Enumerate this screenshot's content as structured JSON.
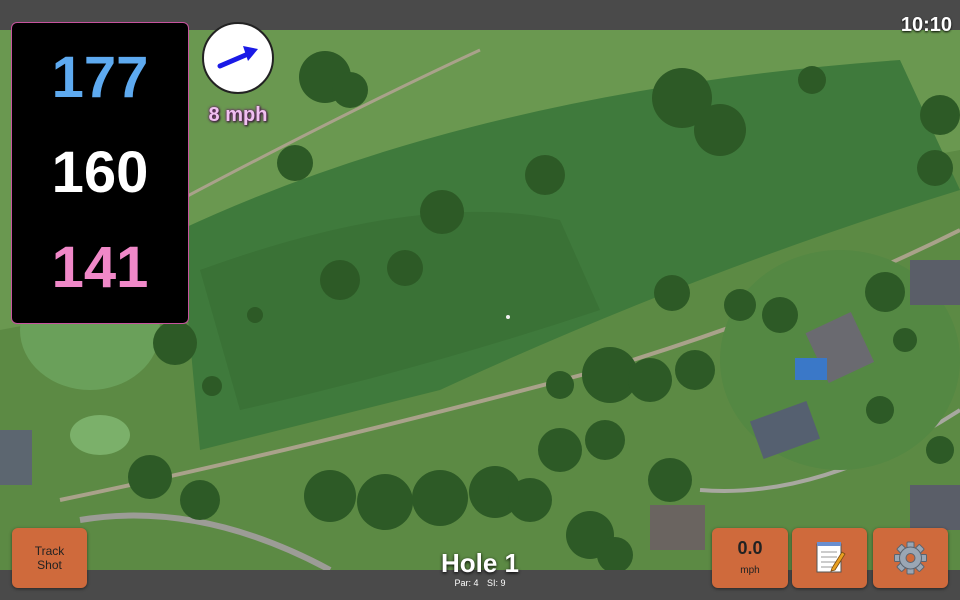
{
  "status": {
    "time": "10:10"
  },
  "yardage": {
    "back": "177",
    "center": "160",
    "front": "141"
  },
  "wind": {
    "speed": "8 mph",
    "icon": "arrow-right-icon",
    "arrow_color": "#1a1ae6"
  },
  "buttons": {
    "track_shot_label": "Track\nShot",
    "speed_value": "0.0",
    "speed_unit": "mph",
    "notes_icon": "notepad-icon",
    "settings_icon": "gear-icon"
  },
  "hole": {
    "title": "Hole 1",
    "par": "Par: 4",
    "si": "SI: 9"
  },
  "colors": {
    "button_bg": "#cf6a3c",
    "back_yardage": "#5eaaf0",
    "front_yardage": "#f088c8",
    "bar_bg": "#4a4a4a"
  }
}
